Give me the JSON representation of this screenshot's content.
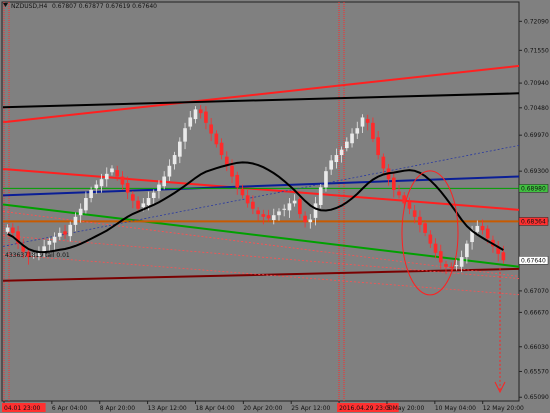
{
  "header": {
    "symbol": "NZDUSD,H4",
    "ohlc": "0.67807 0.67877 0.67619 0.67640"
  },
  "annotations": {
    "tail_text": "4336371819 tail 0.01"
  },
  "colors": {
    "background": "#808080",
    "bull_candle": "#eaeaea",
    "bear_candle": "#ff2a2a",
    "ma_line": "#000000",
    "channel_upper": "#ff2020",
    "channel_lower": "#ff2020",
    "black_trend": "#000000",
    "blue_trend": "#0a1e96",
    "green_trend": "#00a000",
    "orange_level": "#c85a00",
    "maroon_level": "#7a0000",
    "price_label_bg": "#ffffff",
    "red_label_bg": "#ff3030",
    "green_label_bg": "#40c040"
  },
  "chart_data": {
    "type": "candlestick",
    "symbol": "NZDUSD",
    "timeframe": "H4",
    "ylim": [
      0.6502,
      0.7245
    ],
    "y_ticks": [
      "0.72090",
      "0.71550",
      "0.70940",
      "0.70480",
      "0.69970",
      "0.69300",
      "0.68370",
      "0.67070",
      "0.66670",
      "0.66030",
      "0.65570",
      "0.65090"
    ],
    "x_ticks": [
      "04.01 23:00",
      "6 Apr 04:00",
      "8 Apr 20:00",
      "13 Apr 12:00",
      "18 Apr 04:00",
      "20 Apr 20:00",
      "25 Apr 12:00",
      "2016.04.29 23:00",
      "5 May 20:00",
      "10 May 04:00",
      "12 May 20:00"
    ],
    "highlighted_x_labels": [
      "04.01 23:00",
      "2016.04.29 23:00"
    ],
    "price_labels": [
      {
        "text": "0.68980",
        "style": "green"
      },
      {
        "text": "0.68364",
        "style": "red"
      },
      {
        "text": "0.67640",
        "style": "white"
      }
    ],
    "close_path": [
      0.6825,
      0.6815,
      0.6795,
      0.678,
      0.677,
      0.6775,
      0.678,
      0.679,
      0.68,
      0.6808,
      0.6815,
      0.6812,
      0.683,
      0.6845,
      0.686,
      0.688,
      0.6895,
      0.6905,
      0.6915,
      0.6925,
      0.6935,
      0.692,
      0.6905,
      0.689,
      0.6875,
      0.686,
      0.687,
      0.688,
      0.689,
      0.6905,
      0.692,
      0.694,
      0.696,
      0.6985,
      0.701,
      0.703,
      0.7045,
      0.7038,
      0.702,
      0.7,
      0.698,
      0.696,
      0.694,
      0.692,
      0.69,
      0.6885,
      0.687,
      0.686,
      0.685,
      0.6845,
      0.6842,
      0.6848,
      0.6855,
      0.686,
      0.687,
      0.6875,
      0.685,
      0.6835,
      0.684,
      0.687,
      0.69,
      0.693,
      0.695,
      0.696,
      0.697,
      0.6985,
      0.7,
      0.701,
      0.703,
      0.702,
      0.699,
      0.696,
      0.6935,
      0.6915,
      0.6895,
      0.6885,
      0.687,
      0.686,
      0.6845,
      0.683,
      0.6815,
      0.6795,
      0.6778,
      0.676,
      0.6752,
      0.675,
      0.6755,
      0.677,
      0.6795,
      0.682,
      0.6828,
      0.682,
      0.6805,
      0.679,
      0.6776,
      0.6764
    ]
  }
}
